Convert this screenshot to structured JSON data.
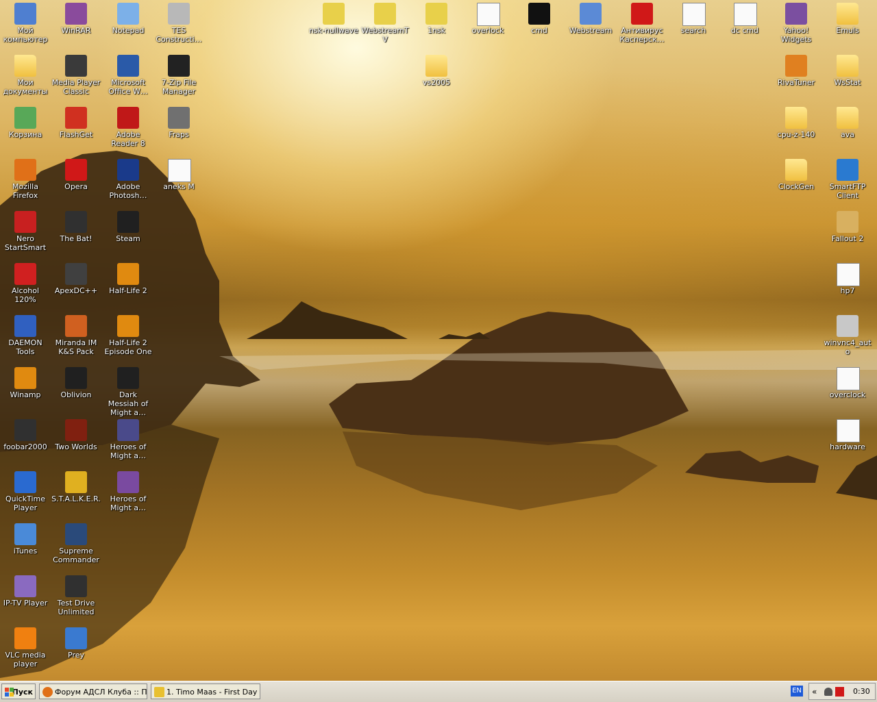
{
  "desktop": {
    "icons": [
      {
        "label": "Мой компьютер",
        "color": "#4f7fd0"
      },
      {
        "label": "WinRAR",
        "color": "#8a4b9c"
      },
      {
        "label": "Notepad",
        "color": "#7cb0e8"
      },
      {
        "label": "TES Constructi…",
        "color": "#b8b8b8"
      },
      {
        "label": "nsk-nullwave",
        "color": "#e8d04a"
      },
      {
        "label": "WebstreamTV",
        "color": "#e8d04a"
      },
      {
        "label": "1nsk",
        "color": "#e8d04a"
      },
      {
        "label": "overlock",
        "color": "#ffffff"
      },
      {
        "label": "cmd",
        "color": "#111111"
      },
      {
        "label": "Webstream",
        "color": "#5b8ad6"
      },
      {
        "label": "Антивирус Касперск…",
        "color": "#d01818"
      },
      {
        "label": "search",
        "color": "#ffffff"
      },
      {
        "label": "dc cmd",
        "color": "#ffffff"
      },
      {
        "label": "Yahoo! Widgets",
        "color": "#7b4fa0"
      },
      {
        "label": "Emuls",
        "color": "#f0c040"
      },
      {
        "label": "Мои документы",
        "color": "#f0c040"
      },
      {
        "label": "Media Player Classic",
        "color": "#3a3a3a"
      },
      {
        "label": "Microsoft Office W…",
        "color": "#2a5aa8"
      },
      {
        "label": "7-Zip File Manager",
        "color": "#222222"
      },
      {
        "label": "vs2005",
        "color": "#f0c040"
      },
      {
        "label": "RivaTuner",
        "color": "#e08020"
      },
      {
        "label": "WsStat",
        "color": "#f0c040"
      },
      {
        "label": "Корзина",
        "color": "#58a858"
      },
      {
        "label": "FlashGet",
        "color": "#d03020"
      },
      {
        "label": "Adobe Reader 8",
        "color": "#c01818"
      },
      {
        "label": "Fraps",
        "color": "#707070"
      },
      {
        "label": "cpu-z-140",
        "color": "#f0c040"
      },
      {
        "label": "ava",
        "color": "#f0c040"
      },
      {
        "label": "Mozilla Firefox",
        "color": "#e07018"
      },
      {
        "label": "Opera",
        "color": "#d01818"
      },
      {
        "label": "Adobe Photosh…",
        "color": "#1a3a8a"
      },
      {
        "label": "aneks M",
        "color": "#ffffff"
      },
      {
        "label": "ClockGen",
        "color": "#f0c040"
      },
      {
        "label": "SmartFTP Client",
        "color": "#2a7ad0"
      },
      {
        "label": "Nero StartSmart",
        "color": "#c82020"
      },
      {
        "label": "The Bat!",
        "color": "#303030"
      },
      {
        "label": "Steam",
        "color": "#202020"
      },
      {
        "label": "Fallout 2",
        "color": "#d8b060"
      },
      {
        "label": "Alcohol 120%",
        "color": "#d02020"
      },
      {
        "label": "ApexDC++",
        "color": "#404040"
      },
      {
        "label": "Half-Life 2",
        "color": "#e08a10"
      },
      {
        "label": "hp7",
        "color": "#ffffff"
      },
      {
        "label": "DAEMON Tools",
        "color": "#3060c0"
      },
      {
        "label": "Miranda IM K&S Pack",
        "color": "#d06020"
      },
      {
        "label": "Half-Life 2 Episode One",
        "color": "#e08a10"
      },
      {
        "label": "winvnc4_auto",
        "color": "#c8c8c8"
      },
      {
        "label": "Winamp",
        "color": "#e08a10"
      },
      {
        "label": "Oblivion",
        "color": "#202020"
      },
      {
        "label": "Dark Messiah of Might a…",
        "color": "#202020"
      },
      {
        "label": "overclock",
        "color": "#ffffff"
      },
      {
        "label": "foobar2000",
        "color": "#303030"
      },
      {
        "label": "Two Worlds",
        "color": "#802010"
      },
      {
        "label": "Heroes of Might a…",
        "color": "#4a4a8a"
      },
      {
        "label": "hardware",
        "color": "#ffffff"
      },
      {
        "label": "QuickTime Player",
        "color": "#2a6ad0"
      },
      {
        "label": "S.T.A.L.K.E.R.",
        "color": "#e0b020"
      },
      {
        "label": "Heroes of Might a…",
        "color": "#7a4aa0"
      },
      {
        "label": "iTunes",
        "color": "#4a8ad8"
      },
      {
        "label": "Supreme Commander",
        "color": "#2a4a7a"
      },
      {
        "label": "IP-TV Player",
        "color": "#8a6ac0"
      },
      {
        "label": "Test Drive Unlimited",
        "color": "#303030"
      },
      {
        "label": "VLC media player",
        "color": "#f08010"
      },
      {
        "label": "Prey",
        "color": "#3a7ad0"
      }
    ]
  },
  "taskbar": {
    "start_label": "Пуск",
    "tasks": [
      {
        "label": "Форум АДСЛ Клуба :: П…",
        "color": "#e07018"
      },
      {
        "label": "1. Timo Maas - First Day …",
        "color": "#e8c030"
      }
    ],
    "lang": "EN",
    "tray_chevron": "«",
    "clock": "0:30"
  }
}
